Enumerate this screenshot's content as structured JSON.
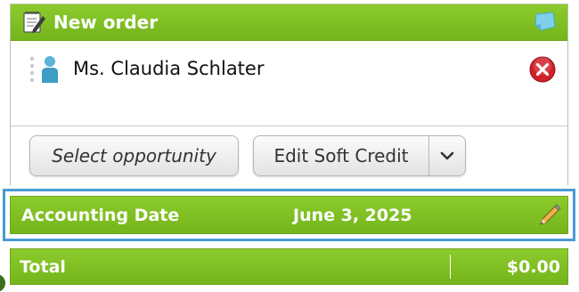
{
  "order": {
    "title": "New order",
    "person": {
      "name": "Ms. Claudia Schlater"
    },
    "buttons": {
      "select_opportunity": "Select opportunity",
      "edit_soft_credit": "Edit Soft Credit"
    }
  },
  "accounting": {
    "label": "Accounting Date",
    "value": "June 3, 2025"
  },
  "total": {
    "label": "Total",
    "value": "$0.00"
  },
  "icons": {
    "header": "edit-form-icon",
    "note": "note-icon",
    "person": "person-icon",
    "remove": "remove-icon",
    "dropdown": "chevron-down-icon",
    "edit_date": "pencil-icon"
  },
  "colors": {
    "header_green": "#7cbd22",
    "focus_blue": "#4a9ad6",
    "remove_red": "#d0202a"
  }
}
